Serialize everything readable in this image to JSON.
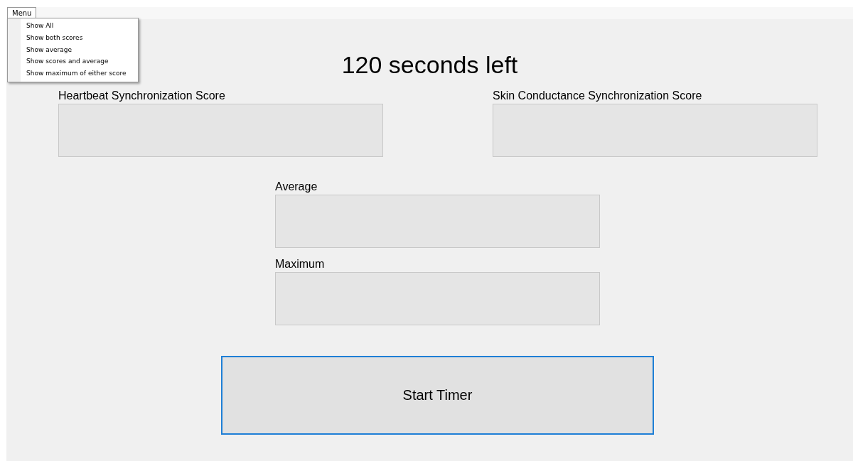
{
  "menu_bar": {
    "label": "Menu",
    "expanded": true
  },
  "menu_items": [
    {
      "label": "Show All"
    },
    {
      "label": "Show both scores"
    },
    {
      "label": "Show average"
    },
    {
      "label": "Show scores and average"
    },
    {
      "label": "Show maximum of either score"
    }
  ],
  "timer_text": "120 seconds left",
  "score_panels": [
    {
      "label": "Heartbeat Synchronization Score"
    },
    {
      "label": "Skin Conductance Synchronization Score"
    }
  ],
  "summary_panels": [
    {
      "label": "Average"
    },
    {
      "label": "Maximum"
    }
  ],
  "start_button": {
    "label": "Start Timer",
    "focused": true
  }
}
